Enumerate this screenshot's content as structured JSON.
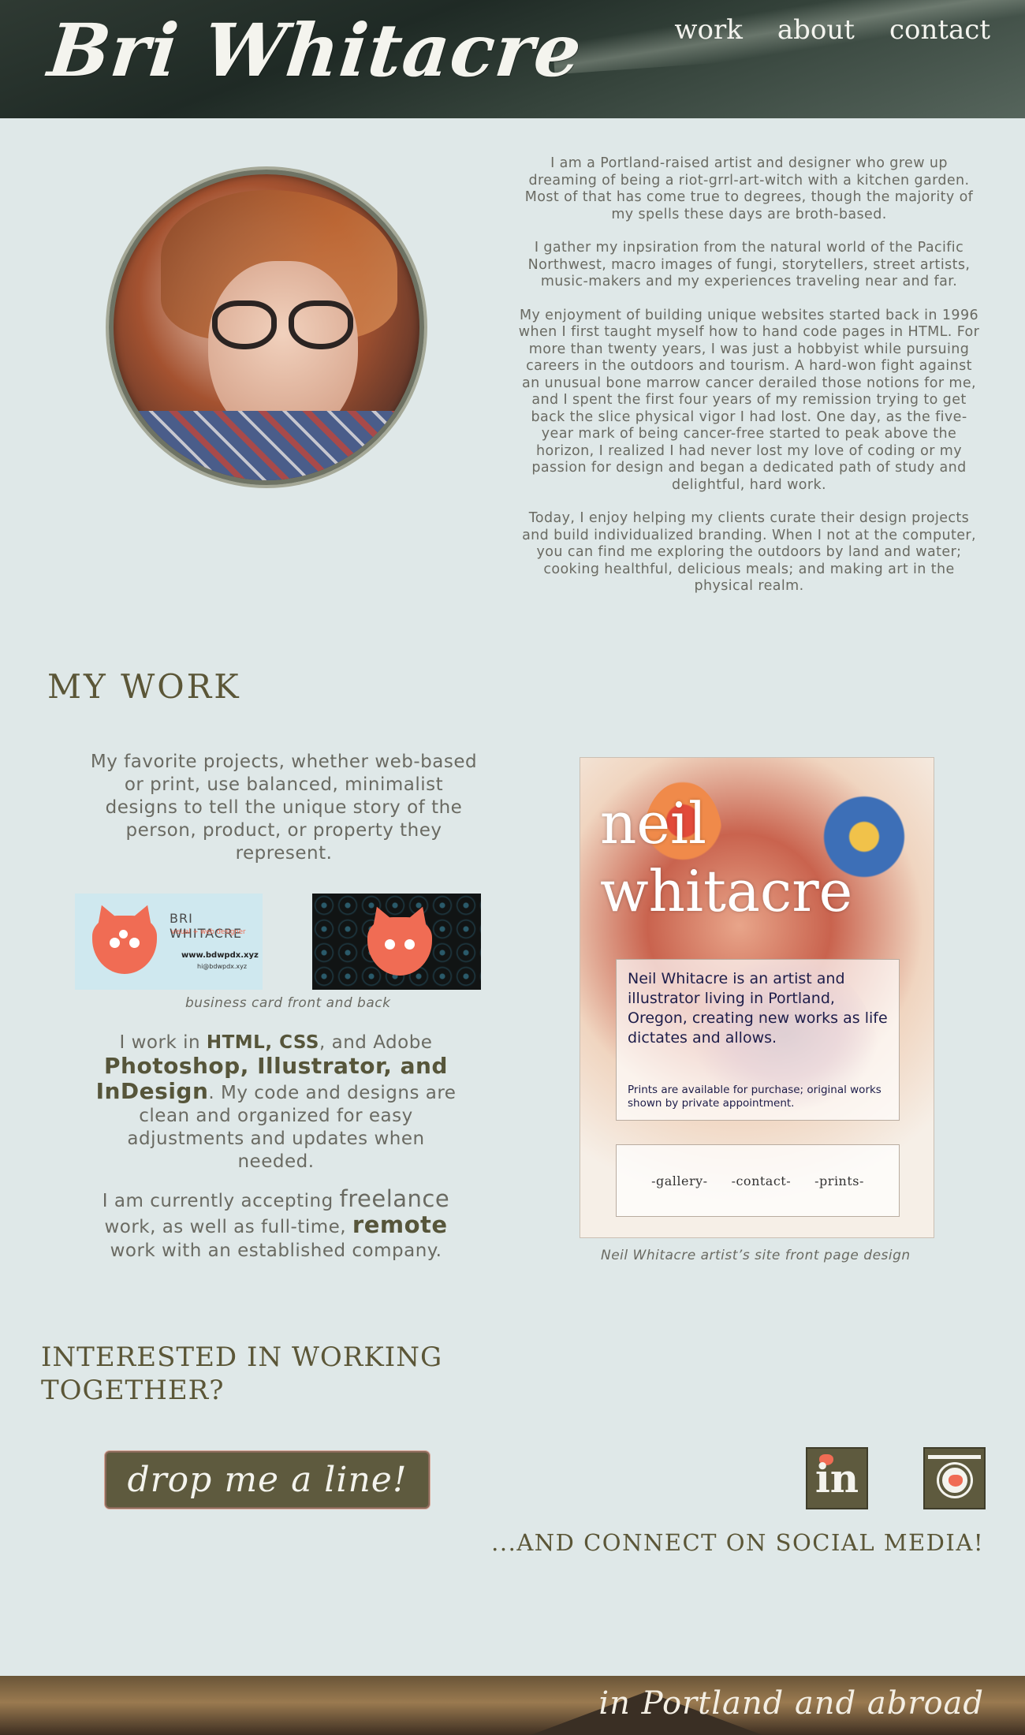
{
  "header": {
    "brand": "Bri Whitacre",
    "nav": [
      "work",
      "about",
      "contact"
    ]
  },
  "about": {
    "paragraphs": [
      "I am a Portland-raised artist and designer who grew up dreaming of being a riot-grrl-art-witch with a kitchen garden. Most of that has come true to degrees, though the majority of my spells these days are broth-based.",
      "I gather my inpsiration from the natural world of the Pacific Northwest, macro images of fungi, storytellers, street artists, music-makers and my experiences traveling near and far.",
      "My enjoyment of building unique websites started back in 1996 when I first taught myself how to hand code pages in HTML. For more than twenty years, I was just a hobbyist while pursuing careers in the outdoors and tourism. A hard-won fight against an unusual bone marrow cancer derailed those notions for me, and I spent the first four years of my remission trying to get back the slice physical vigor I had lost. One day, as the five-year mark of being cancer-free started to peak above the horizon, I realized I had never lost my love of coding or my passion for design and began a dedicated path of study and delightful, hard work.",
      "Today, I enjoy helping my clients curate their design projects and build individualized branding. When I not at the computer, you can find me exploring the outdoors by land and water; cooking healthful, delicious meals; and making art in the physical realm."
    ]
  },
  "work": {
    "heading": "MY WORK",
    "intro": "My favorite projects, whether web-based or print, use balanced, minimalist designs to tell the unique story of the person, product, or property they represent.",
    "card": {
      "name": "BRI WHITACRE",
      "sub": "visual + web designer",
      "url": "www.bdwpdx.xyz",
      "email": "hi@bdwpdx.xyz",
      "caption": "business card front and back"
    },
    "skills": {
      "t1": "I work in ",
      "b1": "HTML, CSS",
      "t2": ", and Adobe ",
      "b2": "Photoshop, Illustrator, and InDesign",
      "t3": ". My code and designs are clean and organized for easy adjustments and updates when needed."
    },
    "availability": {
      "t1": "I am currently accepting ",
      "em1": "freelance",
      "t2": " work, as well as full-time, ",
      "b1": "remote",
      "t3": " work with an established company."
    },
    "poster": {
      "title_line1": "neil",
      "title_line2": "whitacre",
      "lead": "Neil Whitacre is an artist and illustrator living in Portland, Oregon, creating new works as life dictates and allows.",
      "small": "Prints are available for purchase; original works shown by private appointment.",
      "nav": [
        "-gallery-",
        "-contact-",
        "-prints-"
      ],
      "caption": "Neil Whitacre artist’s site front page design"
    }
  },
  "contact": {
    "heading": "INTERESTED IN WORKING TOGETHER?",
    "button": "drop me a line!",
    "linkedin_label": "in",
    "connect": "...AND CONNECT ON SOCIAL MEDIA!",
    "icons": [
      "linkedin-icon",
      "instagram-icon"
    ]
  },
  "footer": {
    "text": "in Portland and abroad"
  }
}
